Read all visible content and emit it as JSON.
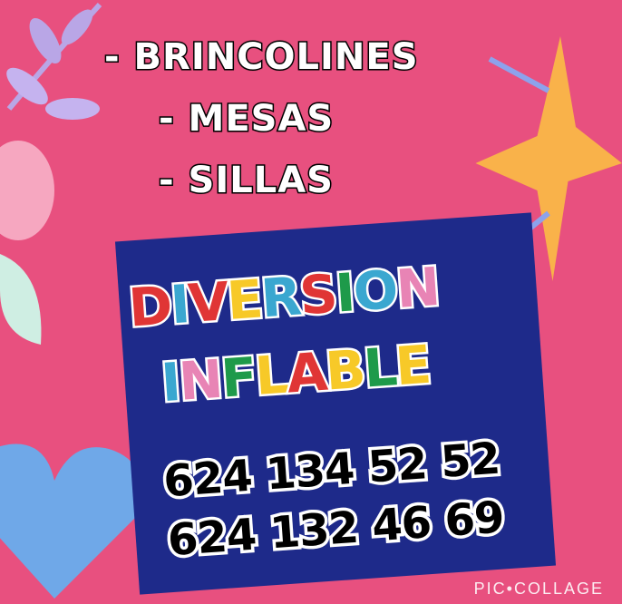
{
  "items": [
    "- BRINCOLINES",
    "- MESAS",
    "- SILLAS"
  ],
  "title": {
    "line1": [
      {
        "ch": "D",
        "color": "#e03535"
      },
      {
        "ch": "I",
        "color": "#3aa7d0"
      },
      {
        "ch": "V",
        "color": "#e03535"
      },
      {
        "ch": "E",
        "color": "#f7c928"
      },
      {
        "ch": "R",
        "color": "#3aa7d0"
      },
      {
        "ch": "S",
        "color": "#e03535"
      },
      {
        "ch": "I",
        "color": "#1e9a4a"
      },
      {
        "ch": "O",
        "color": "#3aa7d0"
      },
      {
        "ch": "N",
        "color": "#e884b5"
      }
    ],
    "line2": [
      {
        "ch": "I",
        "color": "#3aa7d0"
      },
      {
        "ch": "N",
        "color": "#e884b5"
      },
      {
        "ch": "F",
        "color": "#1e9a4a"
      },
      {
        "ch": "L",
        "color": "#f7c928"
      },
      {
        "ch": "A",
        "color": "#e03535"
      },
      {
        "ch": "B",
        "color": "#f7c928"
      },
      {
        "ch": "L",
        "color": "#1e9a4a"
      },
      {
        "ch": "E",
        "color": "#f7c928"
      }
    ]
  },
  "phones": [
    "624 134 52 52",
    "624 132 46 69"
  ],
  "watermark": "PIC•COLLAGE"
}
